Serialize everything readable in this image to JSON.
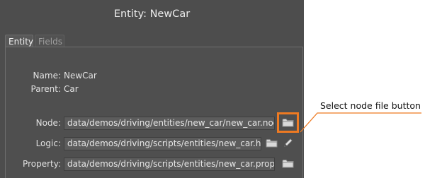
{
  "panel": {
    "title": "Entity: NewCar",
    "tabs": [
      {
        "label": "Entity",
        "active": true
      },
      {
        "label": "Fields",
        "active": false
      }
    ]
  },
  "entity": {
    "name_label": "Name:",
    "name_value": "NewCar",
    "parent_label": "Parent:",
    "parent_value": "Car",
    "node_label": "Node:",
    "node_value": "data/demos/driving/entities/new_car/new_car.node",
    "logic_label": "Logic:",
    "logic_value": "data/demos/driving/scripts/entities/new_car.h",
    "property_label": "Property:",
    "property_value": "data/demos/driving/scripts/entities/new_car.prop"
  },
  "annotation": {
    "text": "Select node file button",
    "color": "#ee7a22"
  },
  "icons": [
    "folder-icon",
    "pencil-icon"
  ],
  "colors": {
    "panel_bg": "#4d4d4d",
    "field_bg": "#5c5c5c",
    "highlight": "#ee7a22"
  }
}
